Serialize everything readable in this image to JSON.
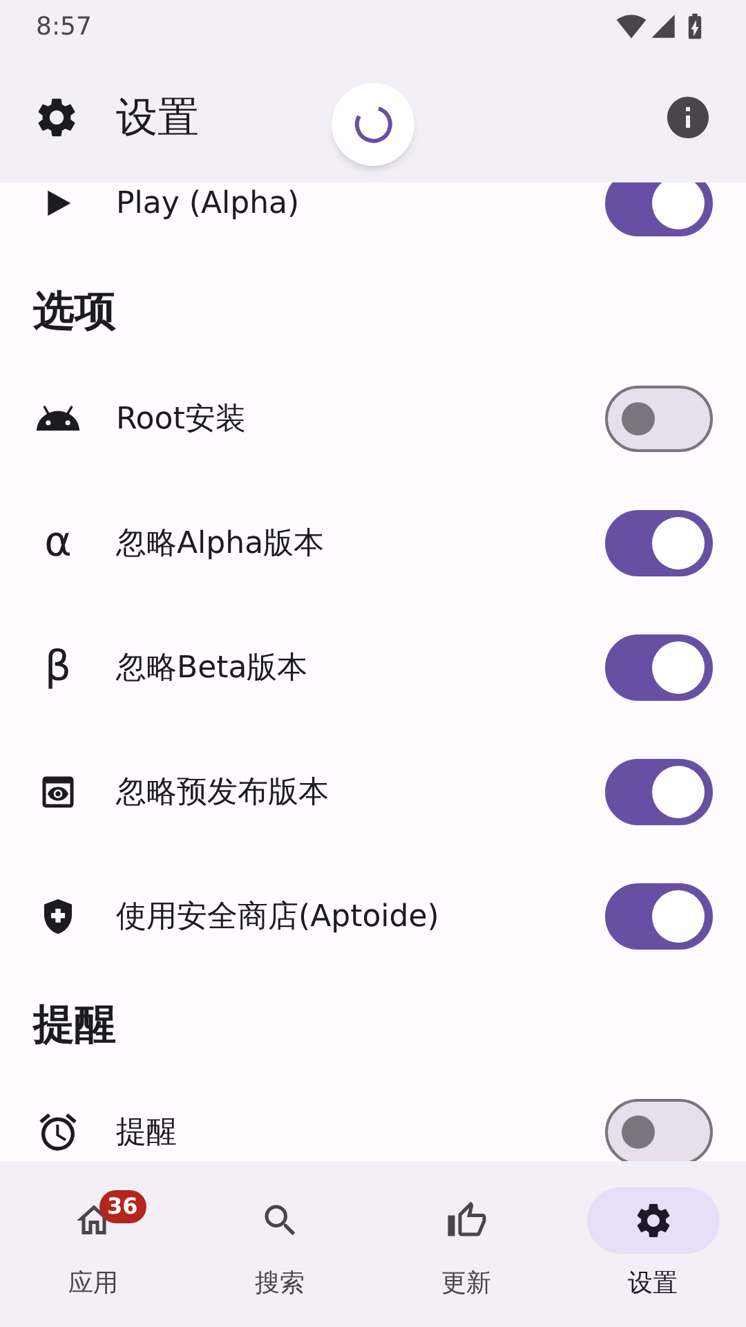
{
  "status_bar": {
    "time": "8:57"
  },
  "top_bar": {
    "title": "设置"
  },
  "sections": [
    {
      "rows": [
        {
          "kind": "icon",
          "label": "Play (Alpha)",
          "on": true
        }
      ]
    },
    {
      "title": "选项",
      "rows": [
        {
          "kind": "icon",
          "label": "Root安装",
          "on": false
        },
        {
          "kind": "glyph",
          "glyph": "α",
          "label": "忽略Alpha版本",
          "on": true
        },
        {
          "kind": "glyph",
          "glyph": "β",
          "label": "忽略Beta版本",
          "on": true
        },
        {
          "kind": "icon",
          "label": "忽略预发布版本",
          "on": true
        },
        {
          "kind": "icon",
          "label": "使用安全商店(Aptoide)",
          "on": true
        }
      ]
    },
    {
      "title": "提醒",
      "rows": [
        {
          "kind": "icon",
          "label": "提醒",
          "on": false
        }
      ]
    }
  ],
  "nav": [
    {
      "label": "应用",
      "badge": "36",
      "selected": false
    },
    {
      "label": "搜索",
      "selected": false
    },
    {
      "label": "更新",
      "selected": false
    },
    {
      "label": "设置",
      "selected": true
    }
  ]
}
